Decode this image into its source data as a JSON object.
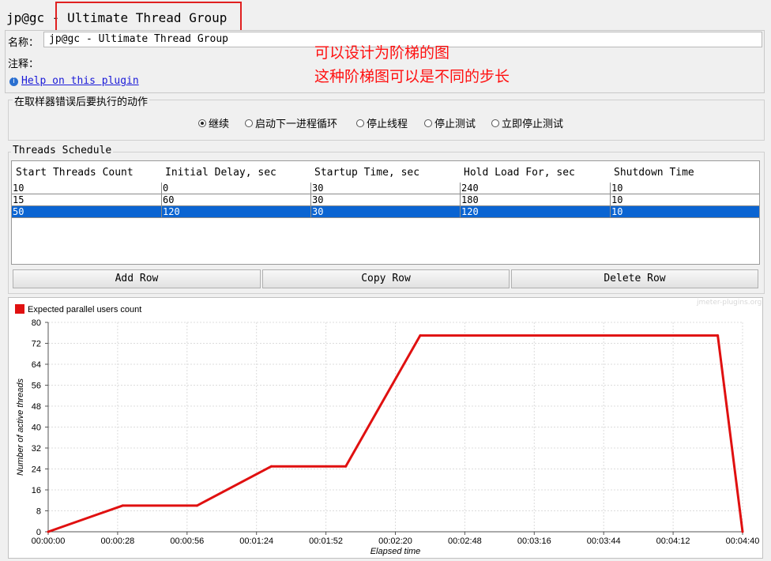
{
  "window": {
    "title": "jp@gc - Ultimate Thread Group"
  },
  "form": {
    "name_label": "名称：",
    "name_value": "jp@gc - Ultimate Thread Group",
    "comment_label": "注释：",
    "help_link": "Help on this plugin",
    "help_icon": "info-icon"
  },
  "annotation": {
    "line1": "可以设计为阶梯的图",
    "line2": "这种阶梯图可以是不同的步长",
    "color": "#ff1010"
  },
  "error_action": {
    "legend": "在取样器错误后要执行的动作",
    "options": [
      {
        "label": "继续",
        "selected": true
      },
      {
        "label": "启动下一进程循环",
        "selected": false
      },
      {
        "label": "停止线程",
        "selected": false
      },
      {
        "label": "停止测试",
        "selected": false
      },
      {
        "label": "立即停止测试",
        "selected": false
      }
    ]
  },
  "schedule": {
    "legend": "Threads Schedule",
    "columns": [
      "Start Threads Count",
      "Initial Delay, sec",
      "Startup Time, sec",
      "Hold Load For, sec",
      "Shutdown Time"
    ],
    "rows": [
      [
        "10",
        "0",
        "30",
        "240",
        "10"
      ],
      [
        "15",
        "60",
        "30",
        "180",
        "10"
      ],
      [
        "50",
        "120",
        "30",
        "120",
        "10"
      ]
    ],
    "selected_row": 2,
    "buttons": {
      "add": "Add Row",
      "copy": "Copy Row",
      "delete": "Delete Row"
    }
  },
  "watermark": "jmeter-plugins.org",
  "chart_data": {
    "type": "line",
    "legend": [
      "Expected parallel users count"
    ],
    "xlabel": "Elapsed time",
    "ylabel": "Number of active threads",
    "x_ticks": [
      "00:00:00",
      "00:00:28",
      "00:00:56",
      "00:01:24",
      "00:01:52",
      "00:02:20",
      "00:02:48",
      "00:03:16",
      "00:03:44",
      "00:04:12",
      "00:04:40"
    ],
    "y_ticks": [
      "0",
      "8",
      "16",
      "24",
      "32",
      "40",
      "48",
      "56",
      "64",
      "72",
      "80"
    ],
    "xlim": [
      0,
      280
    ],
    "ylim": [
      0,
      80
    ],
    "grid": true,
    "legend_position": "top-left",
    "series": [
      {
        "name": "Expected parallel users count",
        "color": "#e01010",
        "points": [
          [
            0,
            0
          ],
          [
            30,
            10
          ],
          [
            60,
            10
          ],
          [
            90,
            25
          ],
          [
            120,
            25
          ],
          [
            150,
            75
          ],
          [
            270,
            75
          ],
          [
            280,
            0
          ]
        ]
      }
    ]
  }
}
